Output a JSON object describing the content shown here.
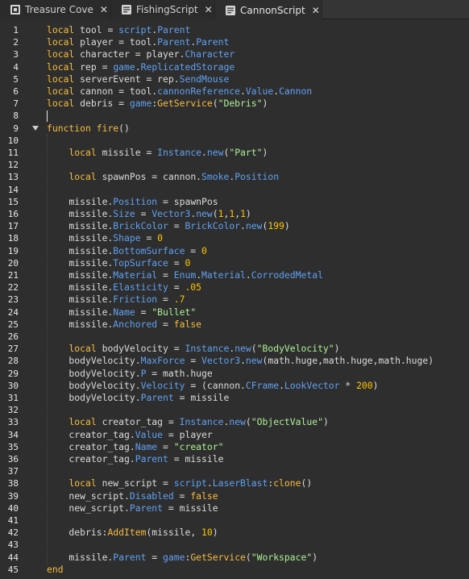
{
  "tabs": [
    {
      "label": "Treasure Cove",
      "icon": "place-icon",
      "active": false
    },
    {
      "label": "FishingScript",
      "icon": "script-icon",
      "active": false
    },
    {
      "label": "CannonScript",
      "icon": "script-icon",
      "active": true
    }
  ],
  "tab_close_glyph": "✕",
  "colors": {
    "keyword": "#f6bd40",
    "property": "#61a1f1",
    "string": "#adf195",
    "number": "#ffc600",
    "default": "#dcdcdc",
    "background": "#2e2e2e",
    "line_number": "#e8e8e8"
  },
  "code": {
    "fold_lines": [
      9
    ],
    "cursor_line": 8,
    "lines": [
      [
        [
          "kw",
          "local"
        ],
        [
          "t",
          " tool = "
        ],
        [
          "pr",
          "script"
        ],
        [
          "t",
          "."
        ],
        [
          "pr",
          "Parent"
        ]
      ],
      [
        [
          "kw",
          "local"
        ],
        [
          "t",
          " player = tool."
        ],
        [
          "pr",
          "Parent"
        ],
        [
          "t",
          "."
        ],
        [
          "pr",
          "Parent"
        ]
      ],
      [
        [
          "kw",
          "local"
        ],
        [
          "t",
          " character = player."
        ],
        [
          "pr",
          "Character"
        ]
      ],
      [
        [
          "kw",
          "local"
        ],
        [
          "t",
          " rep = "
        ],
        [
          "pr",
          "game"
        ],
        [
          "t",
          "."
        ],
        [
          "pr",
          "ReplicatedStorage"
        ]
      ],
      [
        [
          "kw",
          "local"
        ],
        [
          "t",
          " serverEvent = rep."
        ],
        [
          "pr",
          "SendMouse"
        ]
      ],
      [
        [
          "kw",
          "local"
        ],
        [
          "t",
          " cannon = tool."
        ],
        [
          "pr",
          "cannonReference"
        ],
        [
          "t",
          "."
        ],
        [
          "pr",
          "Value"
        ],
        [
          "t",
          "."
        ],
        [
          "pr",
          "Cannon"
        ]
      ],
      [
        [
          "kw",
          "local"
        ],
        [
          "t",
          " debris = "
        ],
        [
          "pr",
          "game"
        ],
        [
          "t",
          ":"
        ],
        [
          "fn",
          "GetService"
        ],
        [
          "t",
          "("
        ],
        [
          "st",
          "\"Debris\""
        ],
        [
          "t",
          ")"
        ]
      ],
      [],
      [
        [
          "kw",
          "function"
        ],
        [
          "t",
          " "
        ],
        [
          "fn",
          "fire"
        ],
        [
          "t",
          "()"
        ]
      ],
      [],
      [
        [
          "t",
          "    "
        ],
        [
          "kw",
          "local"
        ],
        [
          "t",
          " missile = "
        ],
        [
          "pr",
          "Instance"
        ],
        [
          "t",
          "."
        ],
        [
          "pr",
          "new"
        ],
        [
          "t",
          "("
        ],
        [
          "st",
          "\"Part\""
        ],
        [
          "t",
          ")"
        ]
      ],
      [],
      [
        [
          "t",
          "    "
        ],
        [
          "kw",
          "local"
        ],
        [
          "t",
          " spawnPos = cannon."
        ],
        [
          "pr",
          "Smoke"
        ],
        [
          "t",
          "."
        ],
        [
          "pr",
          "Position"
        ]
      ],
      [],
      [
        [
          "t",
          "    missile."
        ],
        [
          "pr",
          "Position"
        ],
        [
          "t",
          " = spawnPos"
        ]
      ],
      [
        [
          "t",
          "    missile."
        ],
        [
          "pr",
          "Size"
        ],
        [
          "t",
          " = "
        ],
        [
          "pr",
          "Vector3"
        ],
        [
          "t",
          "."
        ],
        [
          "pr",
          "new"
        ],
        [
          "t",
          "("
        ],
        [
          "nm",
          "1"
        ],
        [
          "t",
          ","
        ],
        [
          "nm",
          "1"
        ],
        [
          "t",
          ","
        ],
        [
          "nm",
          "1"
        ],
        [
          "t",
          ")"
        ]
      ],
      [
        [
          "t",
          "    missile."
        ],
        [
          "pr",
          "BrickColor"
        ],
        [
          "t",
          " = "
        ],
        [
          "pr",
          "BrickColor"
        ],
        [
          "t",
          "."
        ],
        [
          "pr",
          "new"
        ],
        [
          "t",
          "("
        ],
        [
          "nm",
          "199"
        ],
        [
          "t",
          ")"
        ]
      ],
      [
        [
          "t",
          "    missile."
        ],
        [
          "pr",
          "Shape"
        ],
        [
          "t",
          " = "
        ],
        [
          "nm",
          "0"
        ]
      ],
      [
        [
          "t",
          "    missile."
        ],
        [
          "pr",
          "BottomSurface"
        ],
        [
          "t",
          " = "
        ],
        [
          "nm",
          "0"
        ]
      ],
      [
        [
          "t",
          "    missile."
        ],
        [
          "pr",
          "TopSurface"
        ],
        [
          "t",
          " = "
        ],
        [
          "nm",
          "0"
        ]
      ],
      [
        [
          "t",
          "    missile."
        ],
        [
          "pr",
          "Material"
        ],
        [
          "t",
          " = "
        ],
        [
          "pr",
          "Enum"
        ],
        [
          "t",
          "."
        ],
        [
          "pr",
          "Material"
        ],
        [
          "t",
          "."
        ],
        [
          "pr",
          "CorrodedMetal"
        ]
      ],
      [
        [
          "t",
          "    missile."
        ],
        [
          "pr",
          "Elasticity"
        ],
        [
          "t",
          " = "
        ],
        [
          "nm",
          ".05"
        ]
      ],
      [
        [
          "t",
          "    missile."
        ],
        [
          "pr",
          "Friction"
        ],
        [
          "t",
          " = "
        ],
        [
          "nm",
          ".7"
        ]
      ],
      [
        [
          "t",
          "    missile."
        ],
        [
          "pr",
          "Name"
        ],
        [
          "t",
          " = "
        ],
        [
          "st",
          "\"Bullet\""
        ]
      ],
      [
        [
          "t",
          "    missile."
        ],
        [
          "pr",
          "Anchored"
        ],
        [
          "t",
          " = "
        ],
        [
          "kw",
          "false"
        ]
      ],
      [],
      [
        [
          "t",
          "    "
        ],
        [
          "kw",
          "local"
        ],
        [
          "t",
          " bodyVelocity = "
        ],
        [
          "pr",
          "Instance"
        ],
        [
          "t",
          "."
        ],
        [
          "pr",
          "new"
        ],
        [
          "t",
          "("
        ],
        [
          "st",
          "\"BodyVelocity\""
        ],
        [
          "t",
          ")"
        ]
      ],
      [
        [
          "t",
          "    bodyVelocity."
        ],
        [
          "pr",
          "MaxForce"
        ],
        [
          "t",
          " = "
        ],
        [
          "pr",
          "Vector3"
        ],
        [
          "t",
          "."
        ],
        [
          "pr",
          "new"
        ],
        [
          "t",
          "(math.huge,math.huge,math.huge)"
        ]
      ],
      [
        [
          "t",
          "    bodyVelocity."
        ],
        [
          "pr",
          "P"
        ],
        [
          "t",
          " = math.huge"
        ]
      ],
      [
        [
          "t",
          "    bodyVelocity."
        ],
        [
          "pr",
          "Velocity"
        ],
        [
          "t",
          " = (cannon."
        ],
        [
          "pr",
          "CFrame"
        ],
        [
          "t",
          "."
        ],
        [
          "pr",
          "LookVector"
        ],
        [
          "t",
          " * "
        ],
        [
          "nm",
          "200"
        ],
        [
          "t",
          ")"
        ]
      ],
      [
        [
          "t",
          "    bodyVelocity."
        ],
        [
          "pr",
          "Parent"
        ],
        [
          "t",
          " = missile"
        ]
      ],
      [],
      [
        [
          "t",
          "    "
        ],
        [
          "kw",
          "local"
        ],
        [
          "t",
          " creator_tag = "
        ],
        [
          "pr",
          "Instance"
        ],
        [
          "t",
          "."
        ],
        [
          "pr",
          "new"
        ],
        [
          "t",
          "("
        ],
        [
          "st",
          "\"ObjectValue\""
        ],
        [
          "t",
          ")"
        ]
      ],
      [
        [
          "t",
          "    creator_tag."
        ],
        [
          "pr",
          "Value"
        ],
        [
          "t",
          " = player"
        ]
      ],
      [
        [
          "t",
          "    creator_tag."
        ],
        [
          "pr",
          "Name"
        ],
        [
          "t",
          " = "
        ],
        [
          "st",
          "\"creator\""
        ]
      ],
      [
        [
          "t",
          "    creator_tag."
        ],
        [
          "pr",
          "Parent"
        ],
        [
          "t",
          " = missile"
        ]
      ],
      [],
      [
        [
          "t",
          "    "
        ],
        [
          "kw",
          "local"
        ],
        [
          "t",
          " new_script = "
        ],
        [
          "pr",
          "script"
        ],
        [
          "t",
          "."
        ],
        [
          "pr",
          "LaserBlast"
        ],
        [
          "t",
          ":"
        ],
        [
          "fn",
          "clone"
        ],
        [
          "t",
          "()"
        ]
      ],
      [
        [
          "t",
          "    new_script."
        ],
        [
          "pr",
          "Disabled"
        ],
        [
          "t",
          " = "
        ],
        [
          "kw",
          "false"
        ]
      ],
      [
        [
          "t",
          "    new_script."
        ],
        [
          "pr",
          "Parent"
        ],
        [
          "t",
          " = missile"
        ]
      ],
      [],
      [
        [
          "t",
          "    debris:"
        ],
        [
          "fn",
          "AddItem"
        ],
        [
          "t",
          "(missile, "
        ],
        [
          "nm",
          "10"
        ],
        [
          "t",
          ")"
        ]
      ],
      [],
      [
        [
          "t",
          "    missile."
        ],
        [
          "pr",
          "Parent"
        ],
        [
          "t",
          " = "
        ],
        [
          "pr",
          "game"
        ],
        [
          "t",
          ":"
        ],
        [
          "fn",
          "GetService"
        ],
        [
          "t",
          "("
        ],
        [
          "st",
          "\"Workspace\""
        ],
        [
          "t",
          ")"
        ]
      ],
      [
        [
          "kw",
          "end"
        ]
      ]
    ]
  }
}
